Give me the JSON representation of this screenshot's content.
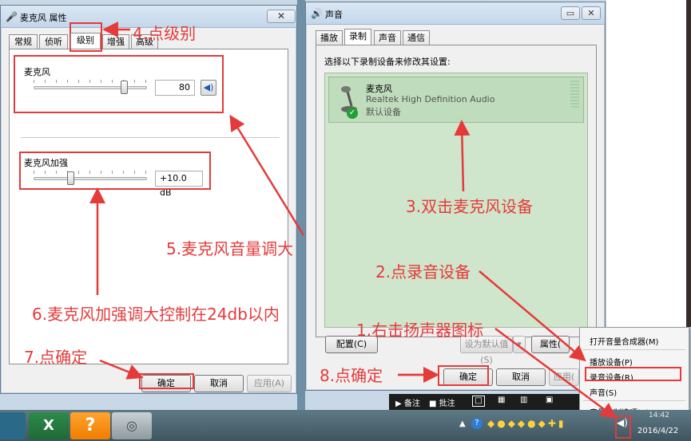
{
  "mic_properties": {
    "title": "麦克风 属性",
    "close": "✕",
    "tabs": [
      "常规",
      "侦听",
      "级别",
      "增强",
      "高级"
    ],
    "active_tab": "级别",
    "mic_label": "麦克风",
    "mic_level": "80",
    "mic_level_fraction": 0.8,
    "boost_label": "麦克风加强",
    "boost_value": "+10.0 dB",
    "boost_fraction": 0.33,
    "ok": "确定",
    "cancel": "取消",
    "apply": "应用(A)"
  },
  "sound_dialog": {
    "title": "声音",
    "tabs": [
      "播放",
      "录制",
      "声音",
      "通信"
    ],
    "active_tab": "录制",
    "instruction": "选择以下录制设备来修改其设置:",
    "device": {
      "name": "麦克风",
      "driver": "Realtek High Definition Audio",
      "status": "默认设备"
    },
    "configure": "配置(C)",
    "set_default": "设为默认值(S)",
    "properties": "属性(",
    "ok": "确定",
    "cancel": "取消",
    "apply": "应用("
  },
  "context_menu": {
    "items": [
      "打开音量合成器(M)",
      "播放设备(P)",
      "录音设备(R)",
      "声音(S)",
      "音量控制选项(V)"
    ],
    "highlighted": "录音设备(R)"
  },
  "notes_bar": {
    "items": [
      "备注",
      "批注"
    ]
  },
  "taskbar": {
    "date": "2016/4/22",
    "time": "14:42"
  },
  "annotations": {
    "a1": "1.右击扬声器图标",
    "a2": "2.点录音设备",
    "a3": "3.双击麦克风设备",
    "a4": "4.点级别",
    "a5": "5.麦克风音量调大",
    "a6": "6.麦克风加强调大控制在24db以内",
    "a7": "7.点确定",
    "a8": "8.点确定"
  },
  "colors": {
    "annotation_red": "#e53a3a",
    "device_list_bg": "#cfe6cc"
  }
}
